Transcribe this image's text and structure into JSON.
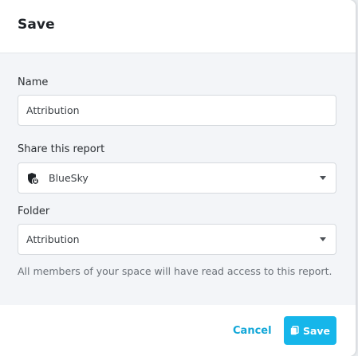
{
  "dialog": {
    "title": "Save"
  },
  "form": {
    "name_label": "Name",
    "name_value": "Attribution",
    "share_label": "Share this report",
    "share_value": "BlueSky",
    "share_icon": "space-lock-icon",
    "folder_label": "Folder",
    "folder_value": "Attribution",
    "help_text": "All members of your space will have read access to this report."
  },
  "footer": {
    "cancel_label": "Cancel",
    "save_label": "Save",
    "save_icon": "copy-icon"
  },
  "colors": {
    "accent": "#16b6ea",
    "link": "#12a7d8",
    "body_bg": "#f3f5f8"
  }
}
